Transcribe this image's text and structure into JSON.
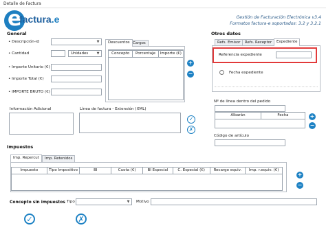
{
  "window": {
    "title": "Detalle de Factura"
  },
  "header": {
    "logo_text": "factura",
    "logo_dot": ".e",
    "tagline_line1": "Gestión de Facturación Electrónica v3.4",
    "tagline_line2": "Formatos factura-e soportados: 3.2 y 3.2.1"
  },
  "general": {
    "section_title": "General",
    "descripcion_label": "Descripción-id",
    "cantidad_label": "Cantidad",
    "unidades_value": "Unidades",
    "importe_unitario_label": "Importe Unitario (€)",
    "importe_total_label": "Importe Total (€)",
    "importe_bruto_label": "IMPORTE BRUTO (€)"
  },
  "descuentos": {
    "tabs": [
      "Descuentos",
      "Cargos"
    ],
    "columns": [
      "Concepto",
      "Porcentaje",
      "Importe (€)"
    ]
  },
  "info_adicional": {
    "label": "Información Adicional"
  },
  "linea_factura": {
    "label": "Línea de factura - Extensión (XML)"
  },
  "otros_datos": {
    "section_title": "Otros datos",
    "tabs": [
      "Refs. Emisor",
      "Refs. Receptor",
      "Expediente"
    ],
    "referencia_label": "Referencia expediente",
    "fecha_label": "Fecha expediente",
    "linea_pedido_label": "Nº de línea dentro del pedido",
    "albaran_columns": [
      "Albarán",
      "Fecha"
    ],
    "codigo_articulo_label": "Código de artículo"
  },
  "impuestos": {
    "section_title": "Impuestos",
    "tabs": [
      "Imp. Repercut",
      "Imp. Retenidos"
    ],
    "columns": [
      "Impuesto",
      "Tipo Impositivo",
      "BI",
      "Cuota (€)",
      "BI Especial",
      "C. Especial (€)",
      "Recargo equiv.",
      "Imp. r.equiv. (€)"
    ]
  },
  "concepto_sin_impuestos": {
    "label": "Concepto sin impuestos",
    "tipo_label": "Tipo",
    "motivo_label": "Motivo"
  },
  "icons": {
    "add": "+",
    "remove": "−",
    "check": "✓",
    "cancel": "✗"
  }
}
